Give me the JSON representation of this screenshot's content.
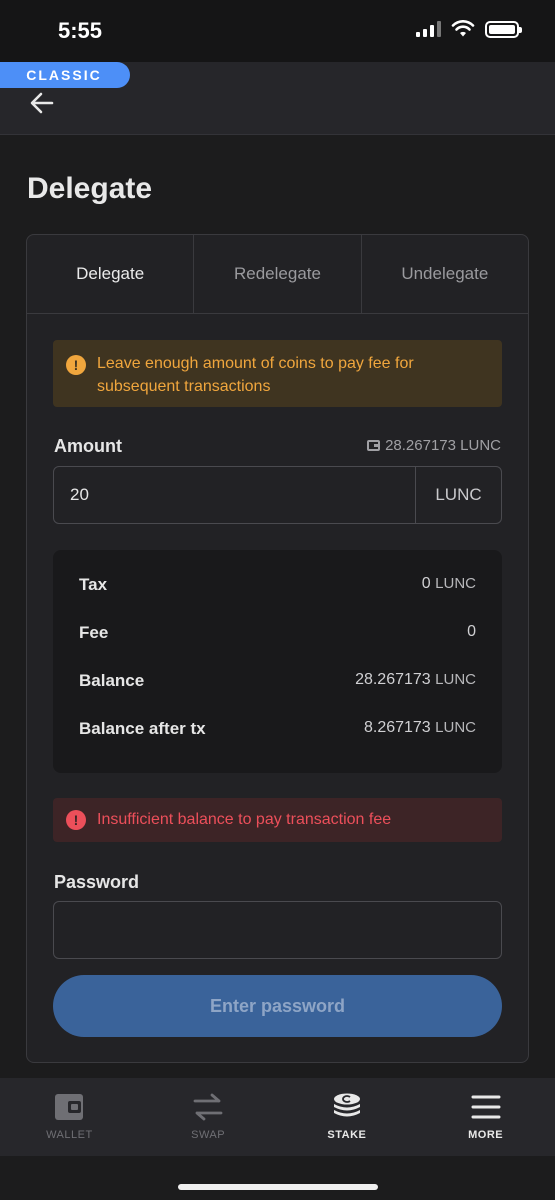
{
  "status_bar": {
    "time": "5:55"
  },
  "header": {
    "badge": "CLASSIC"
  },
  "page": {
    "title": "Delegate"
  },
  "tabs": [
    {
      "label": "Delegate",
      "active": true
    },
    {
      "label": "Redelegate",
      "active": false
    },
    {
      "label": "Undelegate",
      "active": false
    }
  ],
  "warning": {
    "icon": "!",
    "text": "Leave enough amount of coins to pay fee for subsequent transactions"
  },
  "amount": {
    "label": "Amount",
    "available": "28.267173 LUNC",
    "value": "20",
    "unit": "LUNC"
  },
  "summary": [
    {
      "label": "Tax",
      "value": "0",
      "unit": "LUNC"
    },
    {
      "label": "Fee",
      "value": "0",
      "unit": ""
    },
    {
      "label": "Balance",
      "value": "28.267173",
      "unit": "LUNC"
    },
    {
      "label": "Balance after tx",
      "value": "8.267173",
      "unit": "LUNC"
    }
  ],
  "error": {
    "icon": "!",
    "text": "Insufficient balance to pay transaction fee"
  },
  "password": {
    "label": "Password",
    "value": ""
  },
  "submit": {
    "label": "Enter password"
  },
  "bottom_nav": [
    {
      "label": "WALLET",
      "icon": "wallet-icon"
    },
    {
      "label": "SWAP",
      "icon": "swap-icon"
    },
    {
      "label": "STAKE",
      "icon": "stake-icon"
    },
    {
      "label": "MORE",
      "icon": "menu-icon"
    }
  ],
  "colors": {
    "accent": "#4d8ff7",
    "warning": "#f0a63d",
    "error": "#ec4f5a",
    "button": "#3a639a"
  }
}
